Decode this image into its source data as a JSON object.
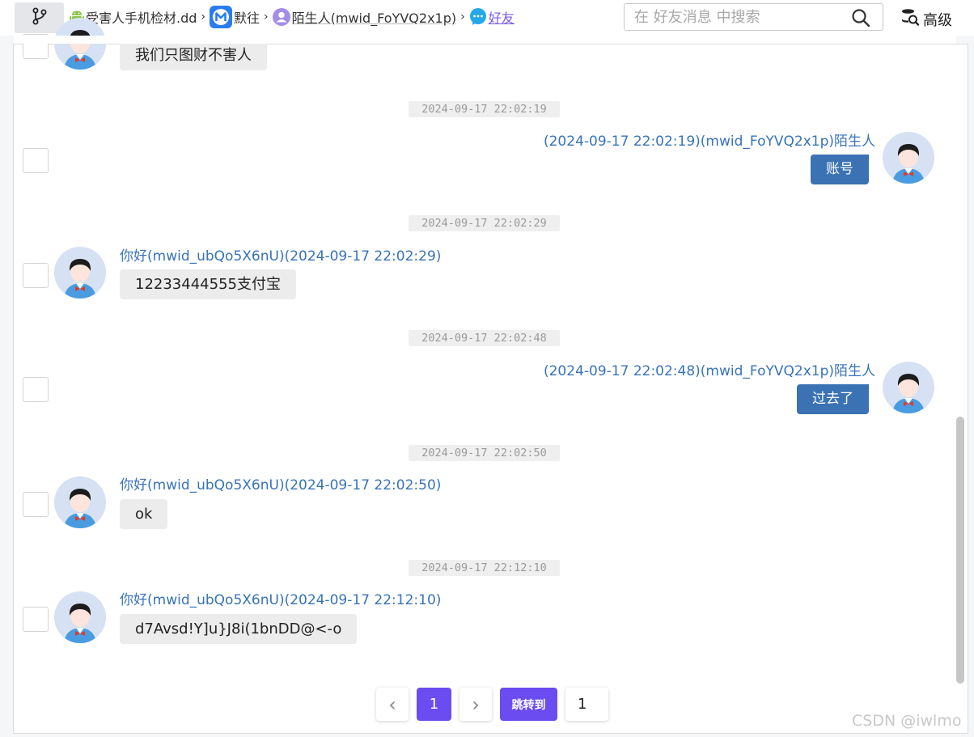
{
  "breadcrumb": {
    "case": "受害人手机检材.dd",
    "app": "默往",
    "contact": "陌生人(mwid_FoYVQ2x1p)",
    "section": "好友"
  },
  "search": {
    "placeholder": "在 好友消息 中搜索"
  },
  "advanced_label": "高级",
  "colors": {
    "accent": "#6a4cf0",
    "link": "#3873b8",
    "bubble_self": "#3a72b4"
  },
  "messages": [
    {
      "text": "我们只图财不害人"
    },
    {
      "time": "2024-09-17 22:02:19",
      "header": "(2024-09-17 22:02:19)(mwid_FoYVQ2x1p)陌生人",
      "text": "账号"
    },
    {
      "time": "2024-09-17 22:02:29",
      "header": "你好(mwid_ubQo5X6nU)(2024-09-17 22:02:29)",
      "text": "12233444555支付宝"
    },
    {
      "time": "2024-09-17 22:02:48",
      "header": "(2024-09-17 22:02:48)(mwid_FoYVQ2x1p)陌生人",
      "text": "过去了"
    },
    {
      "time": "2024-09-17 22:02:50",
      "header": "你好(mwid_ubQo5X6nU)(2024-09-17 22:02:50)",
      "text": "ok"
    },
    {
      "time": "2024-09-17 22:12:10",
      "header": "你好(mwid_ubQo5X6nU)(2024-09-17 22:12:10)",
      "text": "d7Avsd!Y]u}J8i(1bnDD@<-o"
    }
  ],
  "pagination": {
    "prev": "‹",
    "current_page": "1",
    "next": "›",
    "jump_label": "跳转到",
    "jump_value": "1"
  },
  "watermark": "CSDN @iwlmo"
}
